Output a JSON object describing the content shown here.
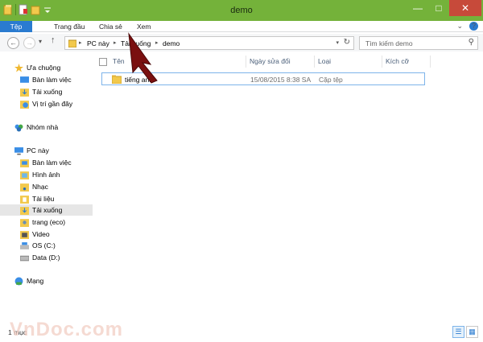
{
  "window": {
    "title": "demo",
    "minimize_icon": "minimize-icon",
    "maximize_icon": "maximize-icon",
    "close_icon": "close-icon"
  },
  "ribbon": {
    "tabs": [
      {
        "label": "Tệp",
        "active": true
      },
      {
        "label": "Trang đầu"
      },
      {
        "label": "Chia sẻ"
      },
      {
        "label": "Xem"
      }
    ]
  },
  "address": {
    "crumbs": [
      "PC này",
      "Tải xuống",
      "demo"
    ]
  },
  "search": {
    "placeholder": "Tìm kiếm demo"
  },
  "nav": {
    "favorites": {
      "label": "Ưa chuộng",
      "items": [
        "Bàn làm việc",
        "Tải xuống",
        "Vị trí gần đây"
      ]
    },
    "homegroup": {
      "label": "Nhóm nhà"
    },
    "pc": {
      "label": "PC này",
      "items": [
        "Bàn làm việc",
        "Hình ảnh",
        "Nhạc",
        "Tài liệu",
        "Tải xuống",
        "trang (eco)",
        "Video",
        "OS (C:)",
        "Data (D:)"
      ]
    },
    "network": {
      "label": "Mạng"
    }
  },
  "columns": {
    "name": "Tên",
    "date": "Ngày sửa đổi",
    "type": "Loại",
    "size": "Kích cỡ"
  },
  "files": [
    {
      "name": "tiếng anh",
      "date": "15/08/2015 8:38 SA",
      "type": "Cặp tệp",
      "size": ""
    }
  ],
  "status": {
    "count": "1 mục"
  },
  "watermark": "VnDoc.com",
  "colors": {
    "titlebar": "#74b23a",
    "file_tab": "#2a7bd0",
    "close": "#c74a3a",
    "cursor": "#7a1010"
  }
}
